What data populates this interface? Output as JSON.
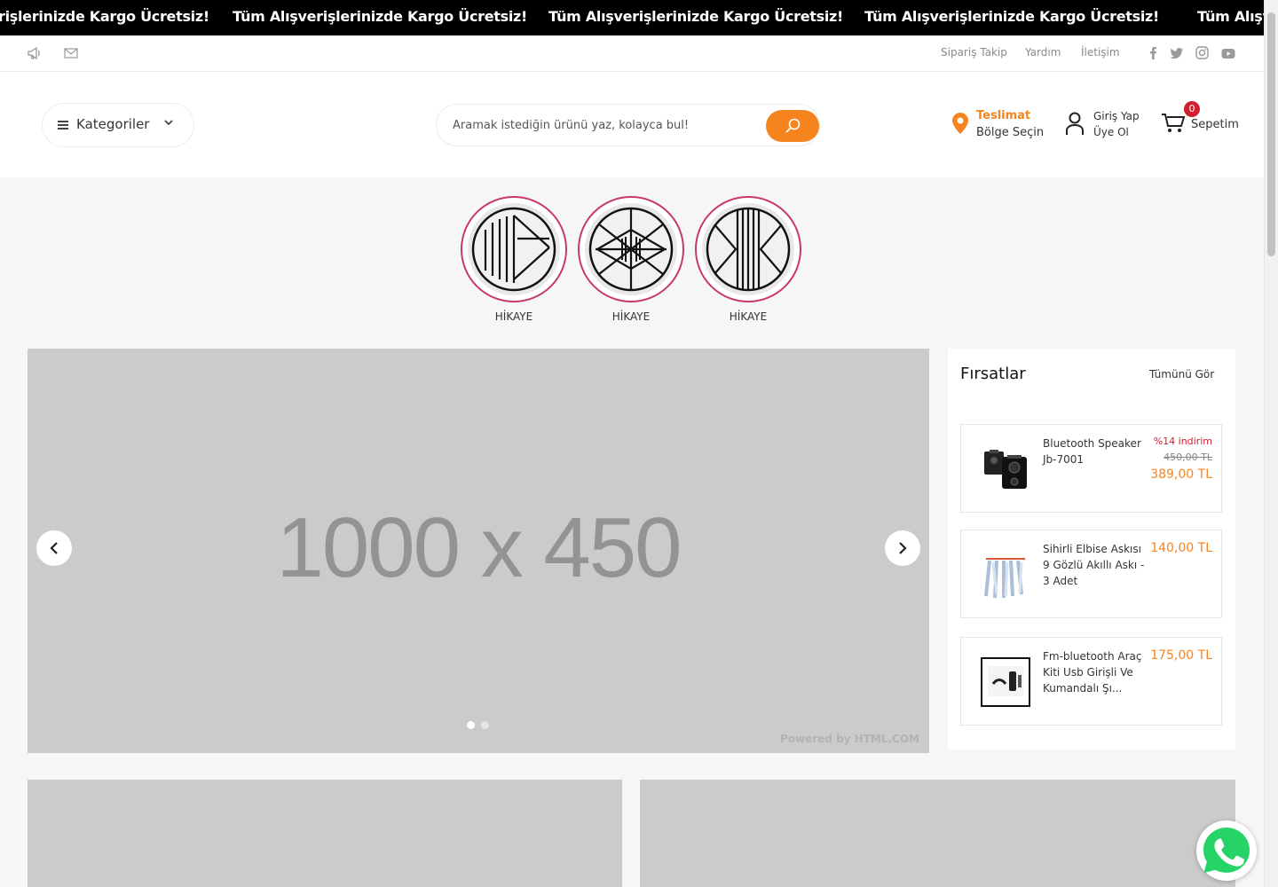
{
  "announcement": {
    "text_1": "rişlerinizde Kargo Ücretsiz!",
    "text_2": "Tüm Alışverişlerinizde Kargo Ücretsiz!",
    "text_3": "Tüm Alışverişlerinizde Kargo Ücretsiz!",
    "text_4": "Tüm Alışverişlerinizde Kargo Ücretsiz!",
    "text_5": "Tüm Alışv"
  },
  "util_bar": {
    "icons": [
      "megaphone-icon",
      "mail-icon"
    ],
    "links": [
      "Sipariş Takip",
      "Yardım",
      "İletişim"
    ],
    "social": [
      "facebook-icon",
      "twitter-icon",
      "instagram-icon",
      "youtube-icon"
    ]
  },
  "header": {
    "categories_label": "Kategoriler",
    "search_placeholder": "Aramak istediğin ürünü yaz, kolayca bul!",
    "delivery_title": "Teslimat",
    "delivery_sub": "Bölge Seçin",
    "login_label": "Giriş Yap",
    "signup_label": "Üye Ol",
    "cart_count": "0",
    "cart_label": "Sepetim"
  },
  "stories": [
    {
      "label": "HİKAYE"
    },
    {
      "label": "HİKAYE"
    },
    {
      "label": "HİKAYE"
    }
  ],
  "slider": {
    "placeholder_text": "1000 x 450",
    "powered": "Powered by HTML.COM",
    "slides": 2,
    "active_slide": 1
  },
  "deals": {
    "title": "Fırsatlar",
    "see_all": "Tümünü Gör",
    "items": [
      {
        "name": "Bluetooth Speaker Jb-7001",
        "discount": "%14 indirim",
        "old_price": "450,00 TL",
        "price": "389,00 TL"
      },
      {
        "name": "Sihirli Elbise Askısı 9 Gözlü Akıllı Askı - 3 Adet",
        "discount": "",
        "old_price": "",
        "price": "140,00 TL"
      },
      {
        "name": "Fm-bluetooth Araç Kiti Usb Girişli Ve Kumandalı Şı...",
        "discount": "",
        "old_price": "",
        "price": "175,00 TL"
      }
    ]
  },
  "colors": {
    "accent": "#f5841f",
    "badge": "#d21f2e",
    "story_ring": "#c7386d",
    "whatsapp": "#25d366"
  }
}
